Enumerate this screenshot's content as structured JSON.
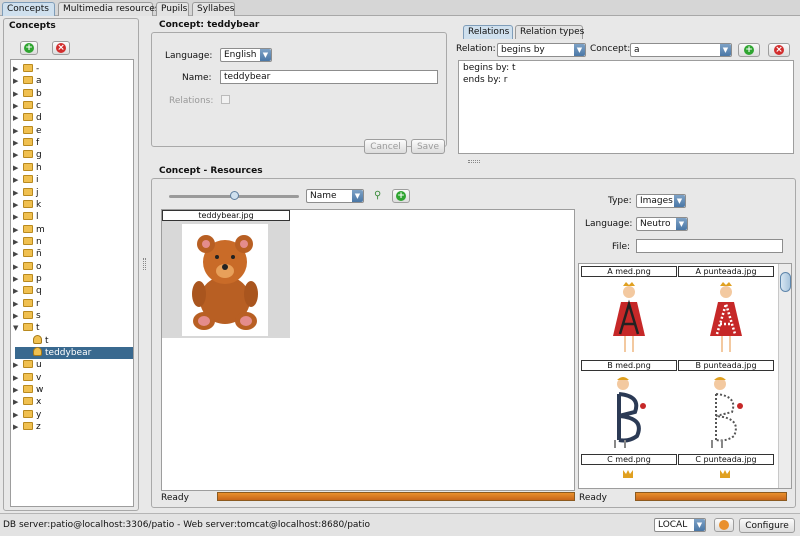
{
  "tabs": [
    "Concepts",
    "Multimedia resources",
    "Pupils",
    "Syllabes"
  ],
  "concepts_panel": {
    "title": "Concepts",
    "tree": [
      {
        "label": "-",
        "type": "folder"
      },
      {
        "label": "a",
        "type": "folder"
      },
      {
        "label": "b",
        "type": "folder"
      },
      {
        "label": "c",
        "type": "folder"
      },
      {
        "label": "d",
        "type": "folder"
      },
      {
        "label": "e",
        "type": "folder"
      },
      {
        "label": "f",
        "type": "folder"
      },
      {
        "label": "g",
        "type": "folder"
      },
      {
        "label": "h",
        "type": "folder"
      },
      {
        "label": "i",
        "type": "folder"
      },
      {
        "label": "j",
        "type": "folder"
      },
      {
        "label": "k",
        "type": "folder"
      },
      {
        "label": "l",
        "type": "folder"
      },
      {
        "label": "m",
        "type": "folder"
      },
      {
        "label": "n",
        "type": "folder"
      },
      {
        "label": "ñ",
        "type": "folder"
      },
      {
        "label": "o",
        "type": "folder"
      },
      {
        "label": "p",
        "type": "folder"
      },
      {
        "label": "q",
        "type": "folder"
      },
      {
        "label": "r",
        "type": "folder"
      },
      {
        "label": "s",
        "type": "folder"
      },
      {
        "label": "t",
        "type": "folder-open"
      },
      {
        "label": "t",
        "type": "leaf"
      },
      {
        "label": "teddybear",
        "type": "leaf-selected"
      },
      {
        "label": "u",
        "type": "folder"
      },
      {
        "label": "v",
        "type": "folder"
      },
      {
        "label": "w",
        "type": "folder"
      },
      {
        "label": "x",
        "type": "folder"
      },
      {
        "label": "y",
        "type": "folder"
      },
      {
        "label": "z",
        "type": "folder"
      }
    ]
  },
  "concept_form": {
    "title": "Concept: teddybear",
    "language_label": "Language:",
    "language_value": "English",
    "name_label": "Name:",
    "name_value": "teddybear",
    "relations_label": "Relations:",
    "cancel_label": "Cancel",
    "save_label": "Save"
  },
  "relations_panel": {
    "tabs": [
      "Relations",
      "Relation types"
    ],
    "relation_label": "Relation:",
    "relation_value": "begins by",
    "concept_label": "Concept:",
    "concept_value": "a",
    "lines": [
      "begins by: t",
      "ends by: r"
    ]
  },
  "resources_panel": {
    "title": "Concept - Resources",
    "sort_value": "Name",
    "selected_file": "teddybear.jpg",
    "status": "Ready",
    "type_label": "Type:",
    "type_value": "Images",
    "language_label": "Language:",
    "language_value": "Neutro",
    "file_label": "File:",
    "file_value": "",
    "gallery": [
      "A med.png",
      "A punteada.jpg",
      "B med.png",
      "B punteada.jpg",
      "C med.png",
      "C punteada.jpg"
    ],
    "status_right": "Ready"
  },
  "statusbar": {
    "server_text": "DB server:patio@localhost:3306/patio - Web server:tomcat@localhost:8680/patio",
    "mode_value": "LOCAL",
    "configure_label": "Configure"
  }
}
